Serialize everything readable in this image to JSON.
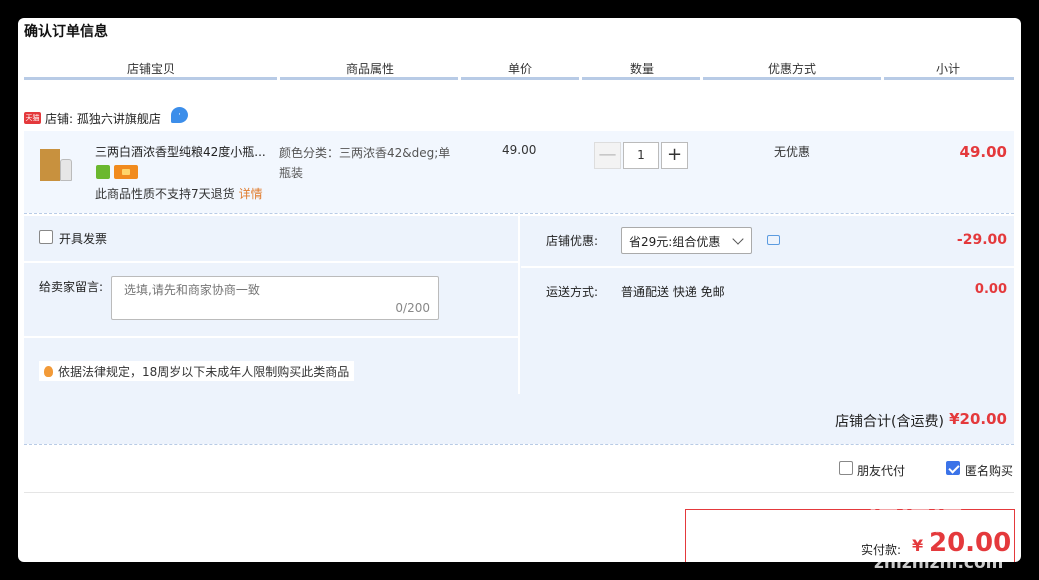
{
  "page": {
    "title": "确认订单信息"
  },
  "columns": [
    "店铺宝贝",
    "商品属性",
    "单价",
    "数量",
    "优惠方式",
    "小计"
  ],
  "shop": {
    "badge": "天猫",
    "name": "店铺: 孤独六讲旗舰店",
    "chat_icon": "chat-bubble-icon"
  },
  "item": {
    "title": "三两白酒浓香型纯粮42度小瓶...",
    "note": "此商品性质不支持7天退货",
    "detail_link": "详情",
    "attribute": "颜色分类：三两浓香42&deg;单瓶装",
    "price": "49.00",
    "quantity": "1",
    "minus": "—",
    "plus": "+",
    "discount": "无优惠",
    "subtotal": "49.00"
  },
  "options": {
    "invoice_label": "开具发票",
    "message_label": "给卖家留言:",
    "message_placeholder": "选填,请先和商家协商一致",
    "message_count": "0/200",
    "legal_notice": "依据法律规定，18周岁以下未成年人限制购买此类商品",
    "shop_discount_label": "店铺优惠:",
    "shop_discount_selected": "省29元:组合优惠",
    "shop_discount_amount": "-29.00",
    "shipping_label": "运送方式:",
    "shipping_method": "普通配送 快递 免邮",
    "shipping_fee": "0.00"
  },
  "total": {
    "label": "店铺合计(含运费)",
    "value": "¥20.00"
  },
  "checkout": {
    "friend_pay_label": "朋友代付",
    "friend_pay_checked": false,
    "anonymous_label": "匿名购买",
    "anonymous_checked": true,
    "paid_label": "实付款:",
    "currency": "¥",
    "paid_value": "20.00"
  },
  "watermark": {
    "text": "值值值",
    "url": "zhizhizhi.com"
  },
  "colors": {
    "accent_red": "#e4393c",
    "header_line": "#b8cbe6",
    "panel_bg": "#edf3fc",
    "checkbox_blue": "#3b73e8"
  }
}
